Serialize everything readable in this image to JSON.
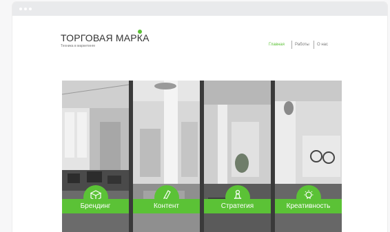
{
  "header": {
    "brand": "ТОРГОВАЯ МАРКА",
    "tagline": "Техника в маркетинге",
    "nav": [
      {
        "label": "Главная",
        "active": true
      },
      {
        "label": "Работы",
        "active": false
      },
      {
        "label": "О нас",
        "active": false
      }
    ]
  },
  "features": [
    {
      "label": "Брендинг",
      "icon": "box-icon"
    },
    {
      "label": "Контент",
      "icon": "pencil-icon"
    },
    {
      "label": "Стратегия",
      "icon": "chess-pawn-icon"
    },
    {
      "label": "Креативность",
      "icon": "lightbulb-icon"
    }
  ],
  "colors": {
    "accent": "#5bc236",
    "titlebar": "#e9eaec"
  }
}
